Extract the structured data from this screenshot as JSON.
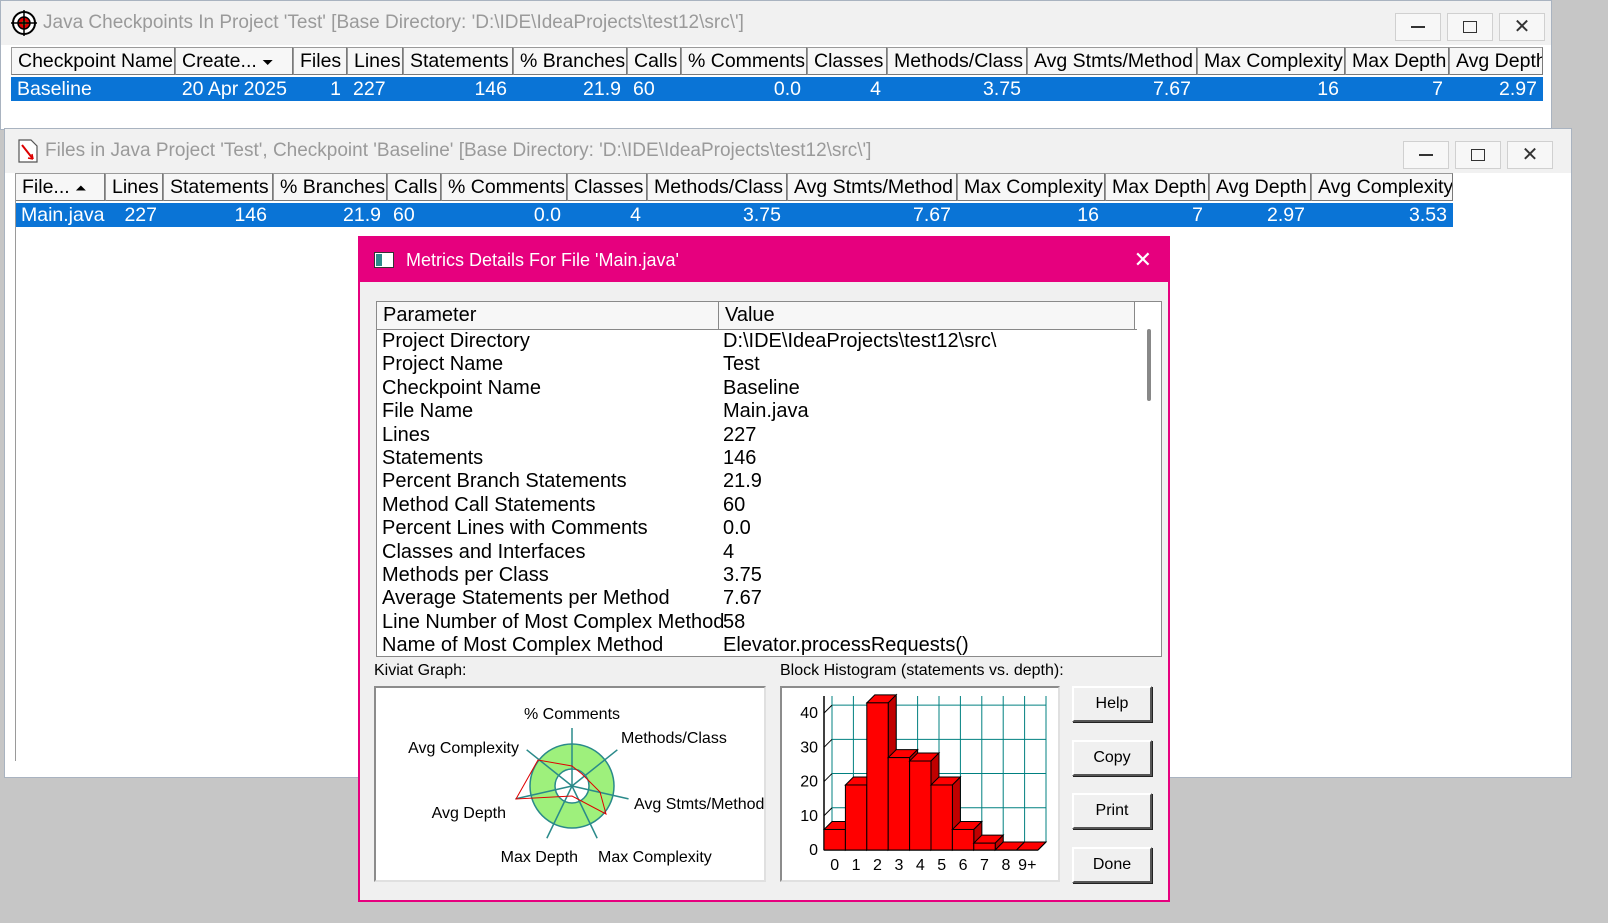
{
  "window1": {
    "title": "Java Checkpoints In Project 'Test'  [Base Directory: 'D:\\IDE\\IdeaProjects\\test12\\src\\']",
    "columns": [
      "Checkpoint Name",
      "Create...",
      "Files",
      "Lines",
      "Statements",
      "% Branches",
      "Calls",
      "% Comments",
      "Classes",
      "Methods/Class",
      "Avg Stmts/Method",
      "Max Complexity",
      "Max Depth",
      "Avg Depth"
    ],
    "row": [
      "Baseline",
      "20 Apr 2025",
      "1",
      "227",
      "146",
      "21.9",
      "60",
      "0.0",
      "4",
      "3.75",
      "7.67",
      "16",
      "7",
      "2.97"
    ]
  },
  "window2": {
    "title": "Files in Java Project 'Test', Checkpoint 'Baseline'  [Base Directory: 'D:\\IDE\\IdeaProjects\\test12\\src\\']",
    "columns": [
      "File...",
      "Lines",
      "Statements",
      "% Branches",
      "Calls",
      "% Comments",
      "Classes",
      "Methods/Class",
      "Avg Stmts/Method",
      "Max Complexity",
      "Max Depth",
      "Avg Depth",
      "Avg Complexity"
    ],
    "row": [
      "Main.java",
      "227",
      "146",
      "21.9",
      "60",
      "0.0",
      "4",
      "3.75",
      "7.67",
      "16",
      "7",
      "2.97",
      "3.53"
    ]
  },
  "dialog": {
    "title": "Metrics Details For File 'Main.java'",
    "table_headers": [
      "Parameter",
      "Value"
    ],
    "rows": [
      [
        "Project Directory",
        "D:\\IDE\\IdeaProjects\\test12\\src\\"
      ],
      [
        "Project Name",
        "Test"
      ],
      [
        "Checkpoint Name",
        "Baseline"
      ],
      [
        "File Name",
        "Main.java"
      ],
      [
        "Lines",
        "227"
      ],
      [
        "Statements",
        "146"
      ],
      [
        "Percent Branch Statements",
        "21.9"
      ],
      [
        "Method Call Statements",
        "60"
      ],
      [
        "Percent Lines with Comments",
        "0.0"
      ],
      [
        "Classes and Interfaces",
        "4"
      ],
      [
        "Methods per Class",
        "3.75"
      ],
      [
        "Average Statements per Method",
        "7.67"
      ],
      [
        "Line Number of Most Complex Method",
        "58"
      ],
      [
        "Name of Most Complex Method",
        "Elevator.processRequests()"
      ]
    ],
    "kiviat_label": "Kiviat Graph:",
    "histogram_label": "Block Histogram (statements vs. depth):",
    "buttons": {
      "help": "Help",
      "copy": "Copy",
      "print": "Print",
      "done": "Done"
    }
  },
  "kiviat": {
    "axes": [
      "% Comments",
      "Methods/Class",
      "Avg Stmts/Method",
      "Max Complexity",
      "Max Depth",
      "Avg Depth",
      "Avg Complexity"
    ]
  },
  "chart_data": {
    "type": "bar",
    "title": "Block Histogram (statements vs. depth):",
    "categories": [
      "0",
      "1",
      "2",
      "3",
      "4",
      "5",
      "6",
      "7",
      "8",
      "9+"
    ],
    "values": [
      6,
      19,
      43,
      27,
      26,
      19,
      6,
      2,
      0,
      0
    ],
    "ylim": [
      0,
      45
    ],
    "yticks": [
      0,
      10,
      20,
      30,
      40
    ],
    "grid": true,
    "bar_color": "#ff0000",
    "grid_color": "#008080"
  },
  "colors": {
    "dialog_accent": "#e6007e",
    "selection": "#0a74d6"
  }
}
